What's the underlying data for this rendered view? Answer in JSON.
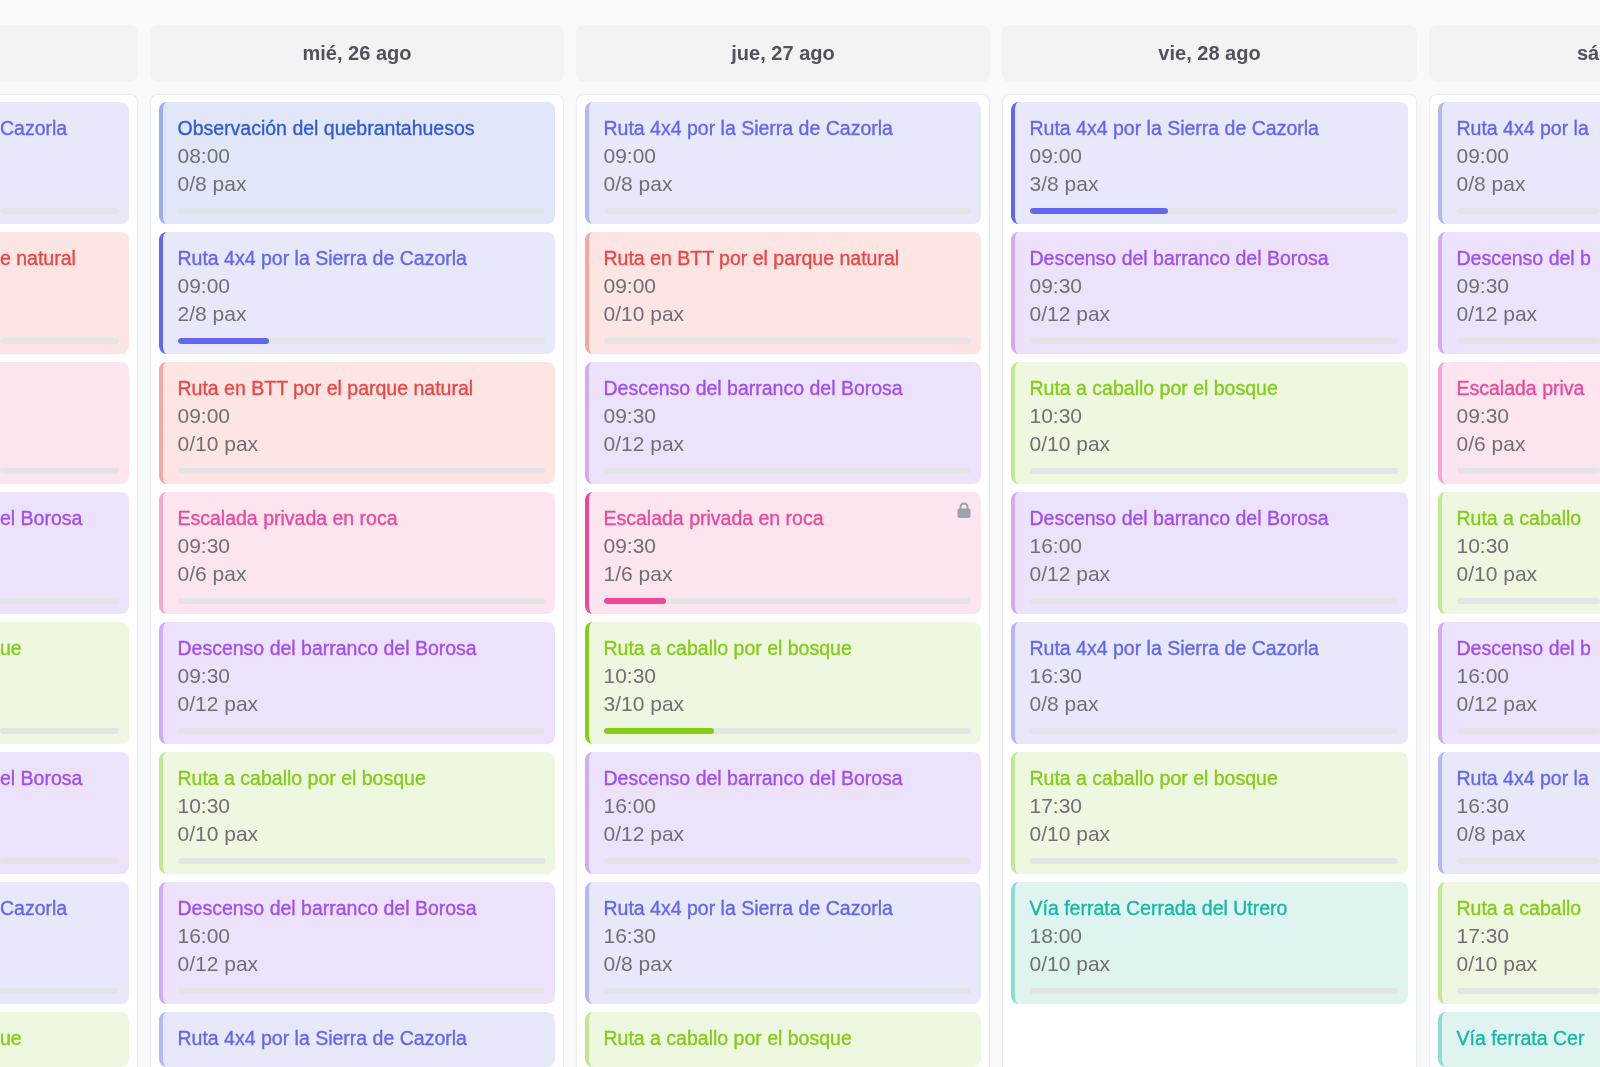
{
  "days": [
    {
      "events": [
        {
          "title": "Cazorla",
          "color": "#e8e8fb",
          "level": 0,
          "locked": false
        },
        {
          "title": "e natural",
          "color": "#fde5e3",
          "level": 0,
          "locked": false
        },
        {
          "color": "#fce5ef",
          "level": 0,
          "locked": false
        },
        {
          "title": "el Borosa",
          "color": "#ede2fb",
          "level": 0,
          "locked": false
        },
        {
          "title": "ue",
          "color": "#eef7e0",
          "level": 0,
          "locked": false
        },
        {
          "title": "el Borosa",
          "color": "#ede2fb",
          "level": 0,
          "locked": false
        },
        {
          "title": "Cazorla",
          "color": "#e8e8fb",
          "level": 0,
          "locked": false
        },
        {
          "title": "ue",
          "color": "#eef7e0",
          "locked": false
        }
      ]
    },
    {
      "label": "mié, 26 ago",
      "events": [
        {
          "title": "Observación del quebrantahuesos",
          "time": "08:00",
          "pax": "0/8 pax",
          "level": 0,
          "color": "#e1e7f8",
          "locked": false
        },
        {
          "title": "Ruta 4x4 por la Sierra de Cazorla",
          "time": "09:00",
          "pax": "2/8 pax",
          "level": 0.25,
          "color": "#e8e8fb",
          "locked": false
        },
        {
          "title": "Ruta en BTT por el parque natural",
          "time": "09:00",
          "pax": "0/10 pax",
          "level": 0,
          "color": "#fde5e3",
          "locked": false
        },
        {
          "title": "Escalada privada en roca",
          "time": "09:30",
          "pax": "0/6 pax",
          "level": 0,
          "color": "#fce5ef",
          "locked": false
        },
        {
          "title": "Descenso del barranco del Borosa",
          "time": "09:30",
          "pax": "0/12 pax",
          "level": 0,
          "color": "#ede2fb",
          "locked": false
        },
        {
          "title": "Ruta a caballo por el bosque",
          "time": "10:30",
          "pax": "0/10 pax",
          "level": 0,
          "color": "#eef7e0",
          "locked": false
        },
        {
          "title": "Descenso del barranco del Borosa",
          "time": "16:00",
          "pax": "0/12 pax",
          "level": 0,
          "color": "#ede2fb",
          "locked": false
        },
        {
          "title": "Ruta 4x4 por la Sierra de Cazorla",
          "color": "#e8e8fb",
          "locked": false
        }
      ]
    },
    {
      "label": "jue, 27 ago",
      "events": [
        {
          "title": "Ruta 4x4 por la Sierra de Cazorla",
          "time": "09:00",
          "pax": "0/8 pax",
          "level": 0,
          "color": "#e8e8fb",
          "locked": false
        },
        {
          "title": "Ruta en BTT por el parque natural",
          "time": "09:00",
          "pax": "0/10 pax",
          "level": 0,
          "color": "#fde5e3",
          "locked": false
        },
        {
          "title": "Descenso del barranco del Borosa",
          "time": "09:30",
          "pax": "0/12 pax",
          "level": 0,
          "color": "#ede2fb",
          "locked": false
        },
        {
          "title": "Escalada privada en roca",
          "time": "09:30",
          "pax": "1/6 pax",
          "level": 0.17,
          "color": "#fce5ef",
          "locked": true
        },
        {
          "title": "Ruta a caballo por el bosque",
          "time": "10:30",
          "pax": "3/10 pax",
          "level": 0.3,
          "color": "#eef7e0",
          "locked": false
        },
        {
          "title": "Descenso del barranco del Borosa",
          "time": "16:00",
          "pax": "0/12 pax",
          "level": 0,
          "color": "#ede2fb",
          "locked": false
        },
        {
          "title": "Ruta 4x4 por la Sierra de Cazorla",
          "time": "16:30",
          "pax": "0/8 pax",
          "level": 0,
          "color": "#e8e8fb",
          "locked": false
        },
        {
          "title": "Ruta a caballo por el bosque",
          "color": "#eef7e0",
          "locked": false
        }
      ]
    },
    {
      "label": "vie, 28 ago",
      "events": [
        {
          "title": "Ruta 4x4 por la Sierra de Cazorla",
          "time": "09:00",
          "pax": "3/8 pax",
          "level": 0.375,
          "color": "#e8e8fb",
          "locked": false
        },
        {
          "title": "Descenso del barranco del Borosa",
          "time": "09:30",
          "pax": "0/12 pax",
          "level": 0,
          "color": "#ede2fb",
          "locked": false
        },
        {
          "title": "Ruta a caballo por el bosque",
          "time": "10:30",
          "pax": "0/10 pax",
          "level": 0,
          "color": "#eef7e0",
          "locked": false
        },
        {
          "title": "Descenso del barranco del Borosa",
          "time": "16:00",
          "pax": "0/12 pax",
          "level": 0,
          "color": "#ede2fb",
          "locked": false
        },
        {
          "title": "Ruta 4x4 por la Sierra de Cazorla",
          "time": "16:30",
          "pax": "0/8 pax",
          "level": 0,
          "color": "#e8e8fb",
          "locked": false
        },
        {
          "title": "Ruta a caballo por el bosque",
          "time": "17:30",
          "pax": "0/10 pax",
          "level": 0,
          "color": "#eef7e0",
          "locked": false
        },
        {
          "title": "Vía ferrata Cerrada del Utrero",
          "time": "18:00",
          "pax": "0/10 pax",
          "level": 0,
          "color": "#dff4f1",
          "locked": false
        }
      ]
    },
    {
      "label": "sá",
      "events": [
        {
          "title": "Ruta 4x4 por la",
          "time": "09:00",
          "pax": "0/8 pax",
          "level": 0,
          "color": "#e8e8fb"
        },
        {
          "title": "Descenso del b",
          "time": "09:30",
          "pax": "0/12 pax",
          "level": 0,
          "color": "#ede2fb"
        },
        {
          "title": "Escalada priva",
          "time": "09:30",
          "pax": "0/6 pax",
          "level": 0,
          "color": "#fce5ef"
        },
        {
          "title": "Ruta a caballo",
          "time": "10:30",
          "pax": "0/10 pax",
          "level": 0,
          "color": "#eef7e0"
        },
        {
          "title": "Descenso del b",
          "time": "16:00",
          "pax": "0/12 pax",
          "level": 0,
          "color": "#ede2fb"
        },
        {
          "title": "Ruta 4x4 por la",
          "time": "16:30",
          "pax": "0/8 pax",
          "level": 0,
          "color": "#e8e8fb"
        },
        {
          "title": "Ruta a caballo",
          "time": "17:30",
          "pax": "0/10 pax",
          "level": 0,
          "color": "#eef7e0"
        },
        {
          "title": "Vía ferrata Cer",
          "color": "#dff4f1"
        }
      ]
    }
  ]
}
